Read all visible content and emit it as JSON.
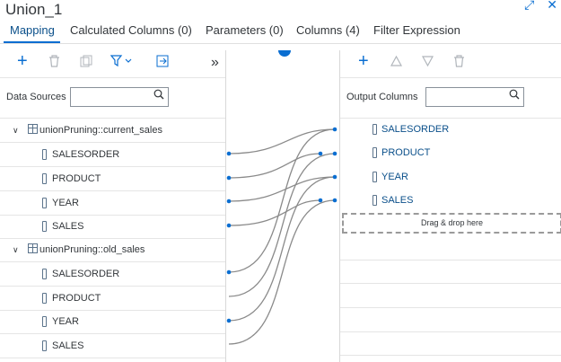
{
  "window": {
    "title": "Union_1"
  },
  "tabs": [
    {
      "label": "Mapping"
    },
    {
      "label": "Calculated Columns (0)"
    },
    {
      "label": "Parameters (0)"
    },
    {
      "label": "Columns (4)"
    },
    {
      "label": "Filter Expression"
    }
  ],
  "left_panel": {
    "search_label": "Data Sources",
    "sources": [
      {
        "name": "unionPruning::current_sales",
        "columns": [
          "SALESORDER",
          "PRODUCT",
          "YEAR",
          "SALES"
        ]
      },
      {
        "name": "unionPruning::old_sales",
        "columns": [
          "SALESORDER",
          "PRODUCT",
          "YEAR",
          "SALES"
        ]
      }
    ]
  },
  "right_panel": {
    "search_label": "Output Columns",
    "columns": [
      "SALESORDER",
      "PRODUCT",
      "YEAR",
      "SALES"
    ],
    "drop_hint": "Drag & drop here"
  },
  "icons": {
    "add": "plus-icon",
    "delete": "trash-icon",
    "copy": "copy-icon",
    "filter": "filter-icon",
    "export": "export-icon",
    "more": "double-chevron-right-icon",
    "up": "triangle-up-icon",
    "down": "triangle-down-icon",
    "maximize": "maximize-icon",
    "close": "close-icon"
  },
  "colors": {
    "accent": "#0a6ed1",
    "link": "#0a4f8a",
    "connector": "#7a7a7a"
  }
}
